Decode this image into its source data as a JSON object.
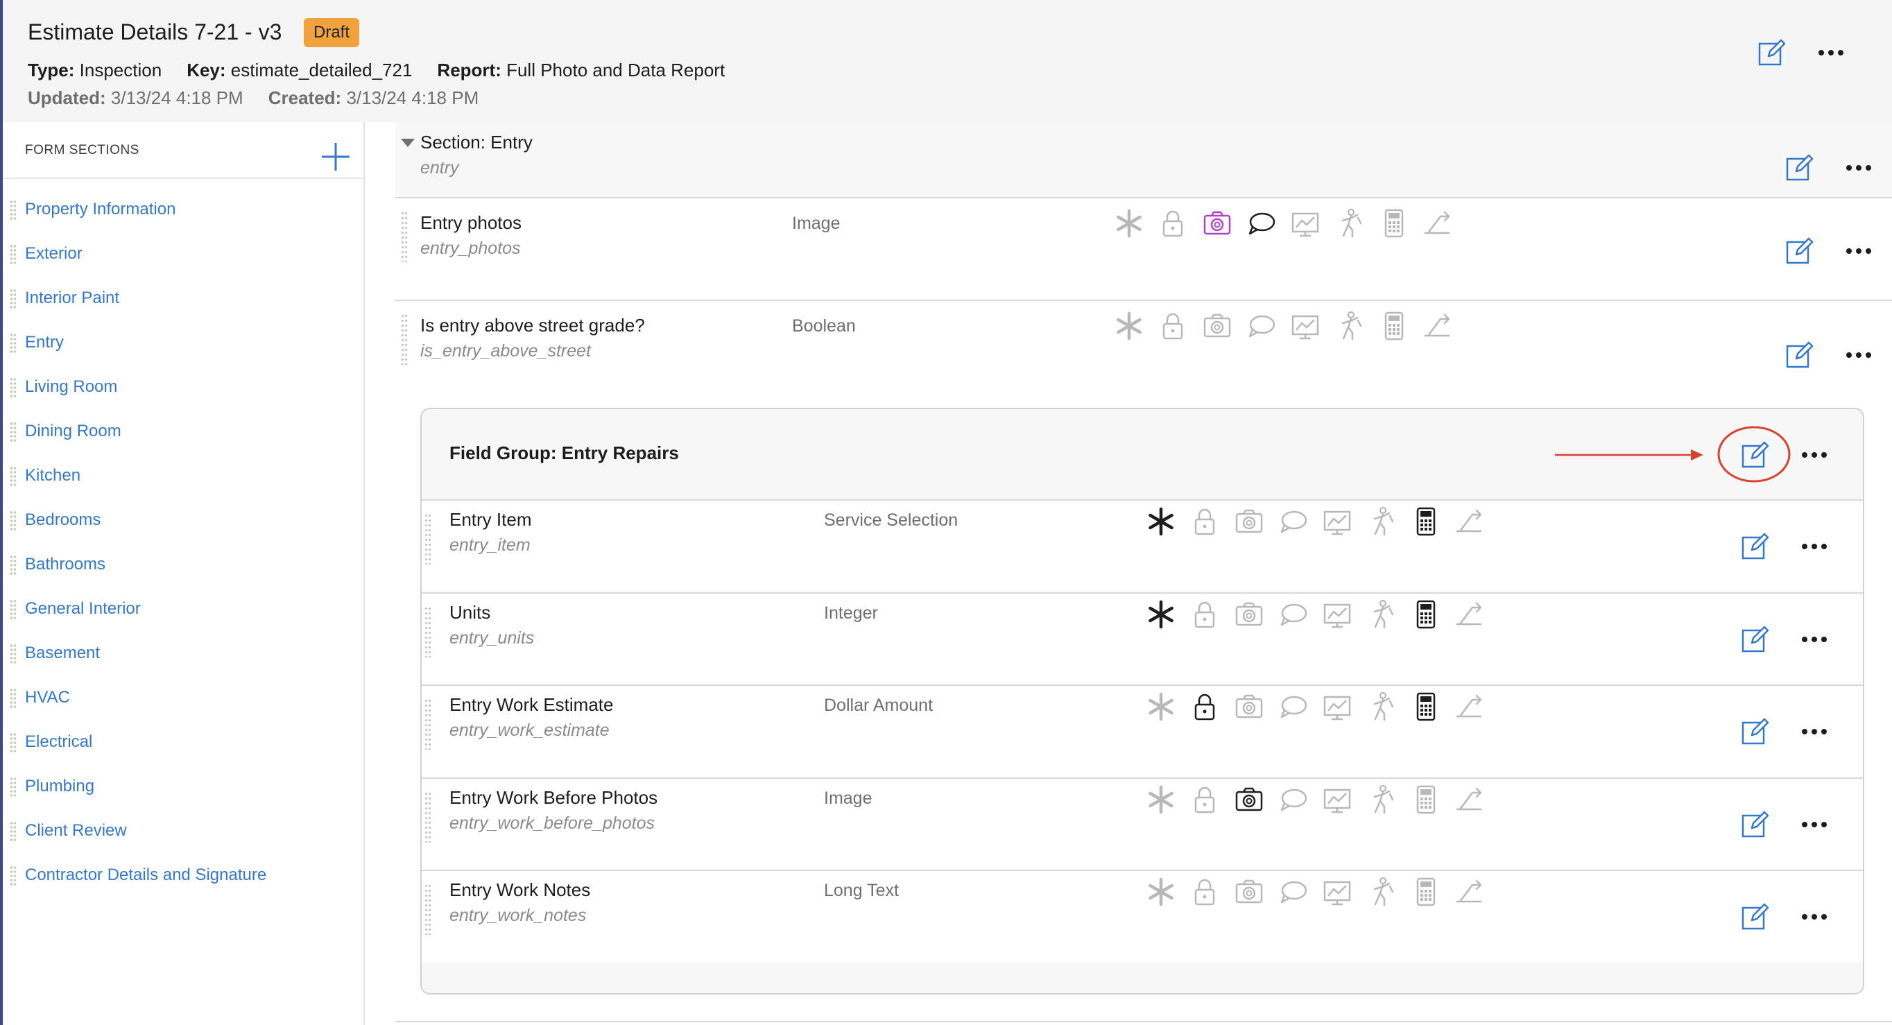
{
  "header": {
    "title": "Estimate Details 7-21 - v3",
    "badge": "Draft",
    "type_label": "Type:",
    "type_value": "Inspection",
    "key_label": "Key:",
    "key_value": "estimate_detailed_721",
    "report_label": "Report:",
    "report_value": "Full Photo and Data Report",
    "updated_label": "Updated:",
    "updated_value": "3/13/24 4:18 PM",
    "created_label": "Created:",
    "created_value": "3/13/24 4:18 PM"
  },
  "sidebar": {
    "heading": "FORM SECTIONS",
    "items": [
      {
        "label": "Property Information"
      },
      {
        "label": "Exterior"
      },
      {
        "label": "Interior Paint"
      },
      {
        "label": "Entry"
      },
      {
        "label": "Living Room"
      },
      {
        "label": "Dining Room"
      },
      {
        "label": "Kitchen"
      },
      {
        "label": "Bedrooms"
      },
      {
        "label": "Bathrooms"
      },
      {
        "label": "General Interior"
      },
      {
        "label": "Basement"
      },
      {
        "label": "HVAC"
      },
      {
        "label": "Electrical"
      },
      {
        "label": "Plumbing"
      },
      {
        "label": "Client Review"
      },
      {
        "label": "Contractor Details and Signature"
      }
    ]
  },
  "section": {
    "title": "Section: Entry",
    "key": "entry"
  },
  "fields": [
    {
      "title": "Entry photos",
      "key": "entry_photos",
      "type": "Image"
    },
    {
      "title": "Is entry above street grade?",
      "key": "is_entry_above_street",
      "type": "Boolean"
    }
  ],
  "group": {
    "title": "Field Group: Entry Repairs",
    "fields": [
      {
        "title": "Entry Item",
        "key": "entry_item",
        "type": "Service Selection"
      },
      {
        "title": "Units",
        "key": "entry_units",
        "type": "Integer"
      },
      {
        "title": "Entry Work Estimate",
        "key": "entry_work_estimate",
        "type": "Dollar Amount"
      },
      {
        "title": "Entry Work Before Photos",
        "key": "entry_work_before_photos",
        "type": "Image"
      },
      {
        "title": "Entry Work Notes",
        "key": "entry_work_notes",
        "type": "Long Text"
      }
    ]
  },
  "colors": {
    "accent_blue": "#3478c8",
    "draft_badge": "#f0a33c",
    "annotation_red": "#d9412f",
    "photo_active": "#b040c8"
  },
  "icons": [
    "star-icon",
    "lock-icon",
    "camera-icon",
    "comment-icon",
    "chart-icon",
    "figure-icon",
    "calculator-icon",
    "branch-icon",
    "edit-icon",
    "more-icon",
    "plus-icon"
  ]
}
